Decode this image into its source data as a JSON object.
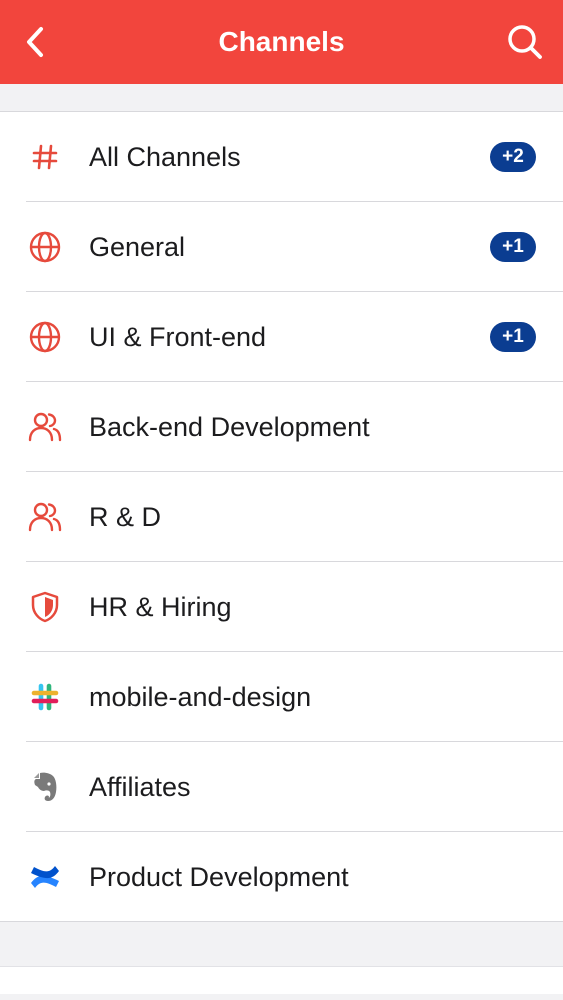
{
  "header": {
    "title": "Channels",
    "back_icon": "chevron-left-icon",
    "search_icon": "search-icon",
    "background": "#f2453d"
  },
  "channels": [
    {
      "label": "All Channels",
      "icon": "hash-icon",
      "badge": "+2"
    },
    {
      "label": "General",
      "icon": "globe-icon",
      "badge": "+1"
    },
    {
      "label": "UI & Front-end",
      "icon": "globe-icon",
      "badge": "+1"
    },
    {
      "label": "Back-end Development",
      "icon": "users-icon",
      "badge": ""
    },
    {
      "label": "R & D",
      "icon": "users-icon",
      "badge": ""
    },
    {
      "label": "HR & Hiring",
      "icon": "shield-icon",
      "badge": ""
    },
    {
      "label": "mobile-and-design",
      "icon": "slack-icon",
      "badge": ""
    },
    {
      "label": "Affiliates",
      "icon": "evernote-icon",
      "badge": ""
    },
    {
      "label": "Product Development",
      "icon": "confluence-icon",
      "badge": ""
    }
  ],
  "colors": {
    "accent": "#f2453d",
    "badge": "#0b3d91"
  }
}
